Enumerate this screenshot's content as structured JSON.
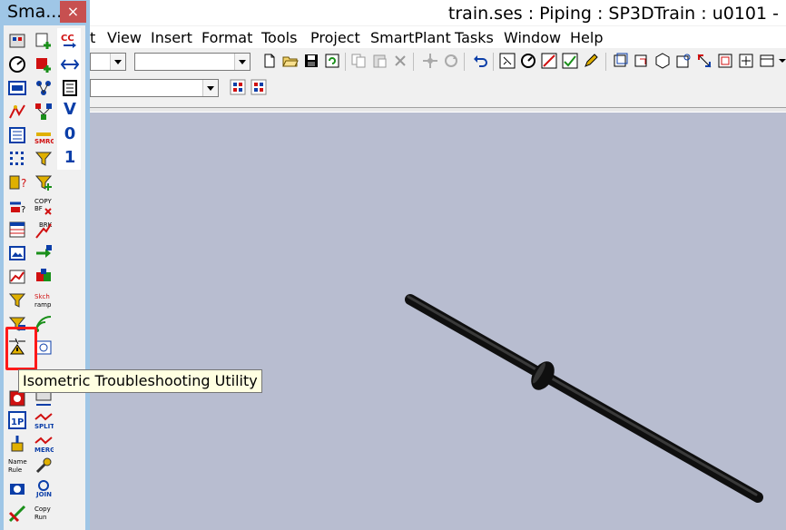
{
  "window": {
    "title": "train.ses : Piping : SP3DTrain : u0101 -"
  },
  "menu": {
    "items": [
      {
        "label": "t"
      },
      {
        "label": "View"
      },
      {
        "label": "Insert"
      },
      {
        "label": "Format"
      },
      {
        "label": "Tools"
      },
      {
        "label": "Project"
      },
      {
        "label": "SmartPlant"
      },
      {
        "label": "Tasks"
      },
      {
        "label": "Window"
      },
      {
        "label": "Help"
      }
    ]
  },
  "toolbar": {
    "combo1_value": "",
    "combo2_value": "",
    "combo3_value": ""
  },
  "smart_toolbar": {
    "title": "Sma...",
    "close_label": "×",
    "col3_glyphs": [
      "V",
      "0",
      "1"
    ]
  },
  "tooltip": {
    "text": "Isometric Troubleshooting Utility"
  },
  "colors": {
    "view_background": "#b8bdd0",
    "pipe": "#0f0f0f",
    "toolbar_frame": "#9fc6e6",
    "highlight": "#ff1a1a"
  }
}
